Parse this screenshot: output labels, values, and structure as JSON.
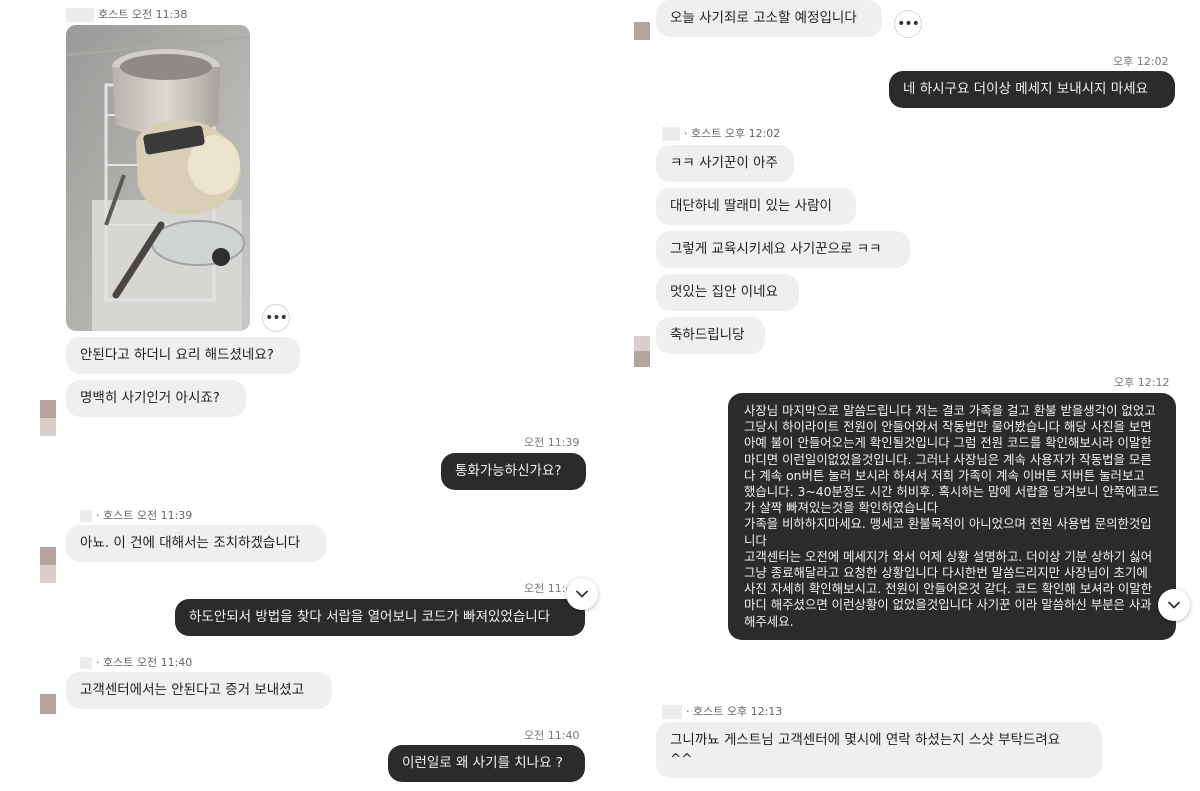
{
  "left": {
    "host_photo": {
      "sender": "호스트",
      "time": "오전 11:38"
    },
    "photo_more": "•••",
    "msg_cant": "안된다고 하더니 요리 해드셨네요?",
    "msg_fraud_know": "명백히 사기인거 아시죠?",
    "time_1139a": "오전 11:39",
    "msg_call": "통화가능하신가요?",
    "host_1139": {
      "sender": "· 호스트",
      "time": "오전 11:39"
    },
    "msg_action": "아뇨. 이 건에 대해서는 조치하겠습니다",
    "time_1140a": "오전 11:40",
    "msg_drawer": "하도안되서 방법을 찾다 서랍을 열어보니 코드가 빠져있었습니다",
    "host_1140": {
      "sender": "· 호스트",
      "time": "오전 11:40"
    },
    "msg_cs": "고객센터에서는 안된다고 증거 보내셨고",
    "time_1140b": "오전 11:40",
    "msg_why": "이런일로 왜 사기를 치나요 ?"
  },
  "right": {
    "msg_sue": "오늘 사기죄로 고소할 예정입니다",
    "more_label": "•••",
    "time_1202": "오후 12:02",
    "msg_ok": "네 하시구요 더이상 메세지 보내시지 마세요",
    "host_1202": {
      "sender": "· 호스트",
      "time": "오후 12:02"
    },
    "msg_kk": "ㅋㅋ 사기꾼이 아주",
    "msg_daughter": "대단하네 딸래미 있는 사람이",
    "msg_educate": "그렇게 교육시키세요 사기꾼으로 ㅋㅋ",
    "msg_house": "멋있는 집안 이네요",
    "msg_congrats": "축하드립니당",
    "time_1212": "오후 12:12",
    "msg_long": "사장님 마지막으로 말씀드립니다 저는 결코 가족을 걸고 환불 받을생각이 없었고 그당시 하이라이트 전원이 안들어와서 작동법만 물어봤습니다 해당 사진을 보면 아예 불이 안들어오는게 확인될것입니다 그럼 전원 코드를 확인해보시라 이말한마디면 이런일이없었을것입니다. 그러나 사장님은 계속 사용자가 작동법을 모른다 계속 on버튼 눌러 보시라 하셔서 저희 가족이 계속 이버튼 저버튼 눌러보고 했습니다. 3~40분정도 시간 허비후. 혹시하는 맘에 서랍을 당겨보니 안쪽에코드가 살짝 빠져있는것을 확인하였습니다\n가족을 비하하지마세요. 맹세코 환불목적이 아니었으며 전원 사용법 문의한것입니다\n고객센터는 오전에 메세지가 와서 어제 상황 설명하고. 더이상 기분 상하기 싫어 그냥 종료해달라고 요청한 상황입니다 다시한번 말씀드리지만 사장님이 초기에 사진 자세히 확인해보시고. 전원이 안들어온것 같다. 코드 확인해 보셔라 이말한마디 해주셨으면 이런상황이 없었을것입니다 사기꾼 이라 말씀하신 부분은 사과해주세요.",
    "host_1213": {
      "sender": "· 호스트",
      "time": "오후 12:13"
    },
    "msg_ask": "그니까뇨 게스트님 고객센터에 몇시에 연락 하셨는지 스샷 부탁드려요\n^^"
  },
  "colors": {
    "incoming": "#efefef",
    "outgoing": "#2b2b2b"
  }
}
